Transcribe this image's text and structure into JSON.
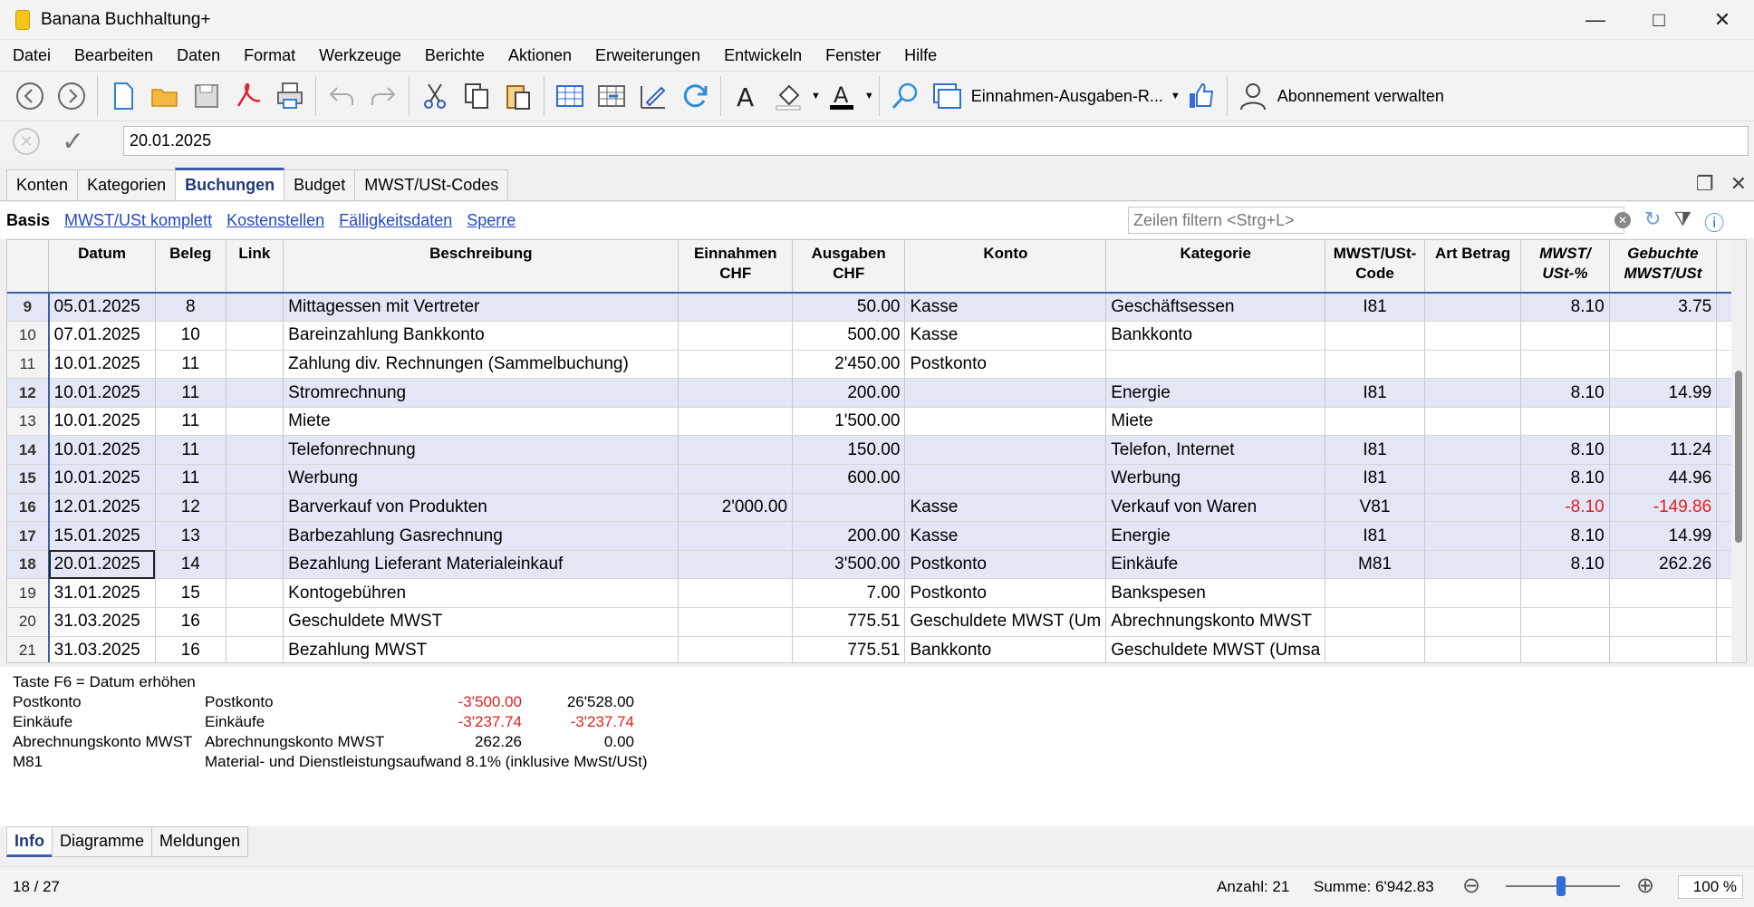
{
  "window": {
    "title": "Banana Buchhaltung+"
  },
  "menu": [
    "Datei",
    "Bearbeiten",
    "Daten",
    "Format",
    "Werkzeuge",
    "Berichte",
    "Aktionen",
    "Erweiterungen",
    "Entwickeln",
    "Fenster",
    "Hilfe"
  ],
  "toolbar": {
    "report_label": "Einnahmen-Ausgaben-R...",
    "subscription_label": "Abonnement verwalten"
  },
  "editline": {
    "value": "20.01.2025"
  },
  "tabs": [
    "Konten",
    "Kategorien",
    "Buchungen",
    "Budget",
    "MWST/USt-Codes"
  ],
  "active_tab": "Buchungen",
  "views": {
    "active": "Basis",
    "links": [
      "MWST/USt komplett",
      "Kostenstellen",
      "Fälligkeitsdaten",
      "Sperre"
    ]
  },
  "filter": {
    "placeholder": "Zeilen filtern <Strg+L>"
  },
  "grid": {
    "headers": [
      "Datum",
      "Beleg",
      "Link",
      "Beschreibung",
      "Einnahmen CHF",
      "Ausgaben CHF",
      "Konto",
      "Kategorie",
      "MWST/USt-Code",
      "Art Betrag",
      "MWST/ USt-%",
      "Gebuchte MWST/USt"
    ],
    "header_lines": {
      "einnahmen": [
        "Einnahmen",
        "CHF"
      ],
      "ausgaben": [
        "Ausgaben",
        "CHF"
      ],
      "mwst_code": [
        "MWST/USt-",
        "Code"
      ],
      "mwst_pct": [
        "MWST/",
        "USt-%"
      ],
      "gebuchte": [
        "Gebuchte",
        "MWST/USt"
      ]
    },
    "rows": [
      {
        "n": "9",
        "datum": "05.01.2025",
        "beleg": "8",
        "link": "",
        "beschreibung": "Mittagessen mit Vertreter",
        "einnahmen": "",
        "ausgaben": "50.00",
        "konto": "Kasse",
        "kategorie": "Geschäftsessen",
        "code": "I81",
        "art": "",
        "pct": "8.10",
        "gebucht": "3.75",
        "hl": true
      },
      {
        "n": "10",
        "datum": "07.01.2025",
        "beleg": "10",
        "link": "",
        "beschreibung": "Bareinzahlung Bankkonto",
        "einnahmen": "",
        "ausgaben": "500.00",
        "konto": "Kasse",
        "kategorie": "Bankkonto",
        "code": "",
        "art": "",
        "pct": "",
        "gebucht": "",
        "hl": false
      },
      {
        "n": "11",
        "datum": "10.01.2025",
        "beleg": "11",
        "link": "",
        "beschreibung": "Zahlung div. Rechnungen (Sammelbuchung)",
        "einnahmen": "",
        "ausgaben": "2'450.00",
        "konto": "Postkonto",
        "kategorie": "",
        "code": "",
        "art": "",
        "pct": "",
        "gebucht": "",
        "hl": false
      },
      {
        "n": "12",
        "datum": "10.01.2025",
        "beleg": "11",
        "link": "",
        "beschreibung": "Stromrechnung",
        "einnahmen": "",
        "ausgaben": "200.00",
        "konto": "",
        "kategorie": "Energie",
        "code": "I81",
        "art": "",
        "pct": "8.10",
        "gebucht": "14.99",
        "hl": true
      },
      {
        "n": "13",
        "datum": "10.01.2025",
        "beleg": "11",
        "link": "",
        "beschreibung": "Miete",
        "einnahmen": "",
        "ausgaben": "1'500.00",
        "konto": "",
        "kategorie": "Miete",
        "code": "",
        "art": "",
        "pct": "",
        "gebucht": "",
        "hl": false
      },
      {
        "n": "14",
        "datum": "10.01.2025",
        "beleg": "11",
        "link": "",
        "beschreibung": "Telefonrechnung",
        "einnahmen": "",
        "ausgaben": "150.00",
        "konto": "",
        "kategorie": "Telefon, Internet",
        "code": "I81",
        "art": "",
        "pct": "8.10",
        "gebucht": "11.24",
        "hl": true
      },
      {
        "n": "15",
        "datum": "10.01.2025",
        "beleg": "11",
        "link": "",
        "beschreibung": "Werbung",
        "einnahmen": "",
        "ausgaben": "600.00",
        "konto": "",
        "kategorie": "Werbung",
        "code": "I81",
        "art": "",
        "pct": "8.10",
        "gebucht": "44.96",
        "hl": true
      },
      {
        "n": "16",
        "datum": "12.01.2025",
        "beleg": "12",
        "link": "",
        "beschreibung": "Barverkauf von Produkten",
        "einnahmen": "2'000.00",
        "ausgaben": "",
        "konto": "Kasse",
        "kategorie": "Verkauf von Waren",
        "code": "V81",
        "art": "",
        "pct": "-8.10",
        "gebucht": "-149.86",
        "hl": true
      },
      {
        "n": "17",
        "datum": "15.01.2025",
        "beleg": "13",
        "link": "",
        "beschreibung": "Barbezahlung Gasrechnung",
        "einnahmen": "",
        "ausgaben": "200.00",
        "konto": "Kasse",
        "kategorie": "Energie",
        "code": "I81",
        "art": "",
        "pct": "8.10",
        "gebucht": "14.99",
        "hl": true
      },
      {
        "n": "18",
        "datum": "20.01.2025",
        "beleg": "14",
        "link": "",
        "beschreibung": "Bezahlung Lieferant Materialeinkauf",
        "einnahmen": "",
        "ausgaben": "3'500.00",
        "konto": "Postkonto",
        "kategorie": "Einkäufe",
        "code": "M81",
        "art": "",
        "pct": "8.10",
        "gebucht": "262.26",
        "hl": true
      },
      {
        "n": "19",
        "datum": "31.01.2025",
        "beleg": "15",
        "link": "",
        "beschreibung": "Kontogebühren",
        "einnahmen": "",
        "ausgaben": "7.00",
        "konto": "Postkonto",
        "kategorie": "Bankspesen",
        "code": "",
        "art": "",
        "pct": "",
        "gebucht": "",
        "hl": false
      },
      {
        "n": "20",
        "datum": "31.03.2025",
        "beleg": "16",
        "link": "",
        "beschreibung": "Geschuldete MWST",
        "einnahmen": "",
        "ausgaben": "775.51",
        "konto": "Geschuldete MWST (Um",
        "kategorie": "Abrechnungskonto MWST",
        "code": "",
        "art": "",
        "pct": "",
        "gebucht": "",
        "hl": false
      },
      {
        "n": "21",
        "datum": "31.03.2025",
        "beleg": "16",
        "link": "",
        "beschreibung": "Bezahlung MWST",
        "einnahmen": "",
        "ausgaben": "775.51",
        "konto": "Bankkonto",
        "kategorie": "Geschuldete MWST (Umsa",
        "code": "",
        "art": "",
        "pct": "",
        "gebucht": "",
        "hl": false
      }
    ]
  },
  "info": {
    "hint": "Taste F6 = Datum erhöhen",
    "lines": [
      {
        "a": "Postkonto",
        "b": "Postkonto",
        "v1": "-3'500.00",
        "v2": "26'528.00",
        "v1neg": true,
        "v2neg": false
      },
      {
        "a": "Einkäufe",
        "b": "Einkäufe",
        "v1": "-3'237.74",
        "v2": "-3'237.74",
        "v1neg": true,
        "v2neg": true
      },
      {
        "a": "Abrechnungskonto MWST",
        "b": "Abrechnungskonto MWST",
        "v1": "262.26",
        "v2": "0.00",
        "v1neg": false,
        "v2neg": false
      },
      {
        "a": "M81",
        "b": "Material- und Dienstleistungsaufwand 8.1% (inklusive MwSt/USt)",
        "v1": "",
        "v2": "",
        "v1neg": false,
        "v2neg": false
      }
    ]
  },
  "bottom_tabs": [
    "Info",
    "Diagramme",
    "Meldungen"
  ],
  "status": {
    "position": "18 / 27",
    "anzahl": "Anzahl: 21",
    "summe": "Summe: 6'942.83",
    "zoom": "100 %",
    "zoom_level_percent": 100
  },
  "colors": {
    "accent": "#3b5ea8",
    "highlight_row": "#e3e6f5",
    "negative": "#e02020",
    "link": "#2448c6"
  }
}
